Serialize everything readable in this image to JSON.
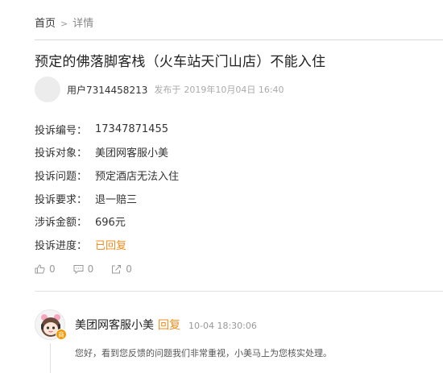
{
  "breadcrumb": {
    "home": "首页",
    "separator": ">",
    "current": "详情"
  },
  "title": "预定的佛落脚客栈（火车站天门山店）不能入住",
  "author": {
    "username": "用户7314458213",
    "posted_prefix": "发布于",
    "posted_time": "2019年10月04日 16:40"
  },
  "details": [
    {
      "label": "投诉编号：",
      "value": "17347871455"
    },
    {
      "label": "投诉对象：",
      "value": "美团网客服小美"
    },
    {
      "label": "投诉问题：",
      "value": "预定酒店无法入住"
    },
    {
      "label": "投诉要求：",
      "value": "退一赔三"
    },
    {
      "label": "涉诉金额：",
      "value": "696元"
    },
    {
      "label": "投诉进度：",
      "value": "已回复"
    }
  ],
  "actions": {
    "like_count": "0",
    "comment_count": "0",
    "share_count": "0"
  },
  "reply": {
    "name": "美团网客服小美",
    "tag": "回复",
    "time": "10-04 18:30:06",
    "text": "您好，看到您反馈的问题我们非常重视，小美马上为您核实处理。",
    "badge": "商"
  },
  "colors": {
    "status": "#f08c1c",
    "muted": "#999999",
    "badge": "#f39800"
  }
}
